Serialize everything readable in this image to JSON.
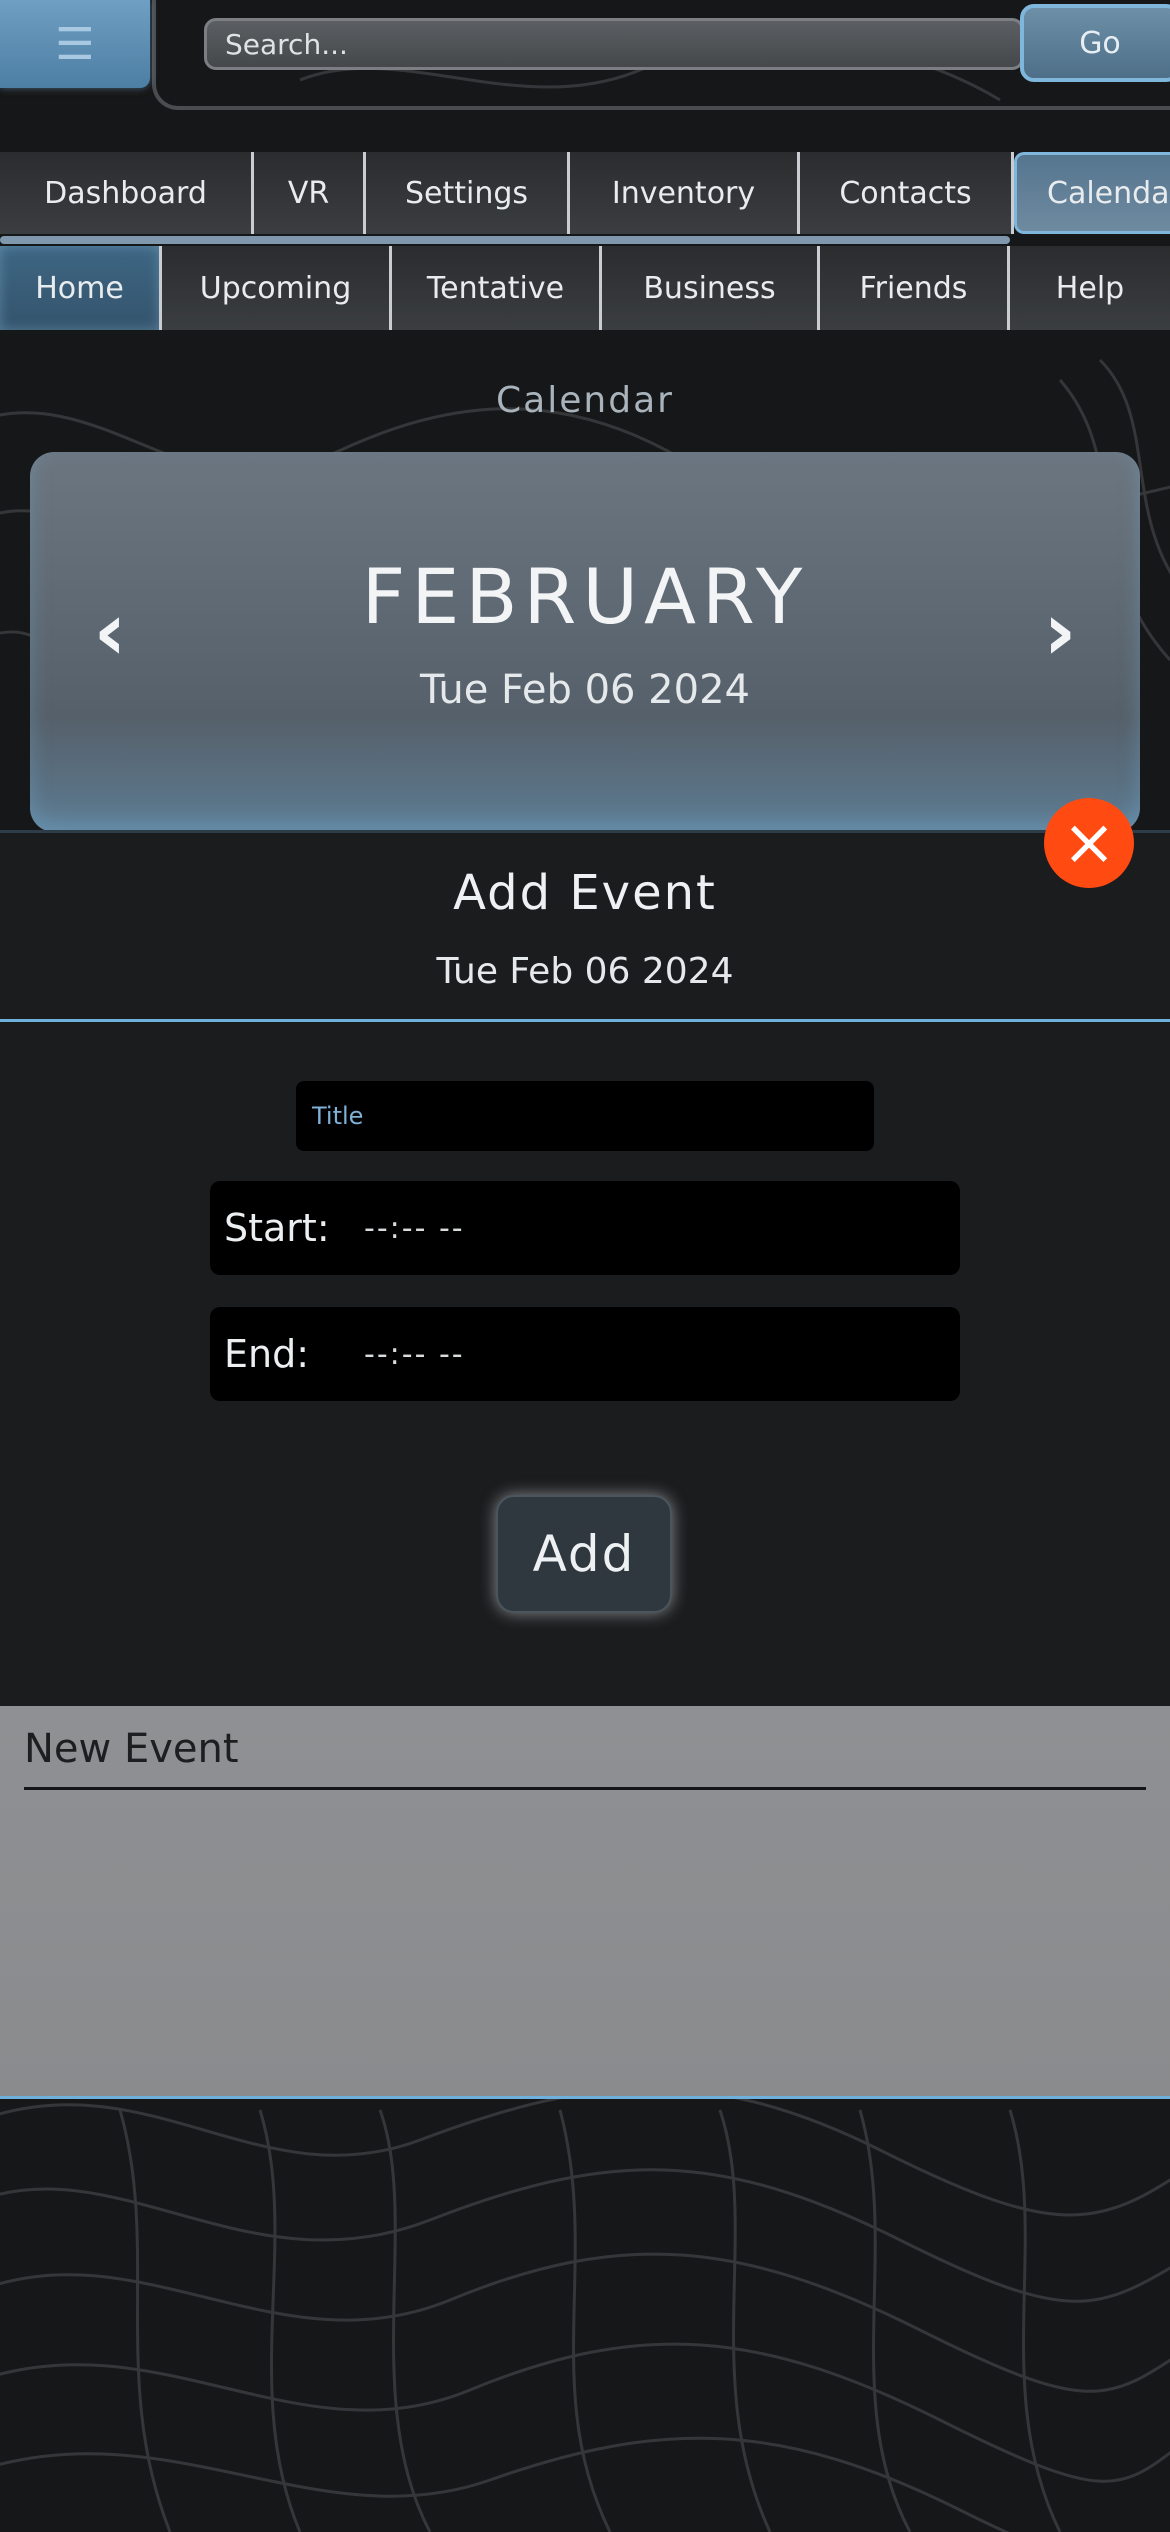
{
  "topbar": {
    "menu_icon": "hamburger-icon",
    "search_placeholder": "Search...",
    "go_label": "Go"
  },
  "nav": {
    "tabs": [
      "Dashboard",
      "VR",
      "Settings",
      "Inventory",
      "Contacts",
      "Calendar"
    ],
    "active_tab": "Calendar"
  },
  "subnav": {
    "tabs": [
      "Home",
      "Upcoming",
      "Tentative",
      "Business",
      "Friends",
      "Help"
    ],
    "active_tab": "Home"
  },
  "calendar": {
    "section_title": "Calendar",
    "month": "FEBRUARY",
    "selected_date": "Tue Feb 06 2024",
    "prev_icon": "chevron-left-icon",
    "next_icon": "chevron-right-icon"
  },
  "add_event_modal": {
    "title": "Add Event",
    "date": "Tue Feb 06 2024",
    "close_icon": "close-icon",
    "title_placeholder": "Title",
    "start_label": "Start:",
    "start_value": "--:-- --",
    "end_label": "End:",
    "end_value": "--:-- --",
    "add_label": "Add"
  },
  "event_panel": {
    "heading": "New Event"
  },
  "colors": {
    "accent": "#7fb6dc",
    "close": "#ff4a12",
    "background": "#161718"
  }
}
